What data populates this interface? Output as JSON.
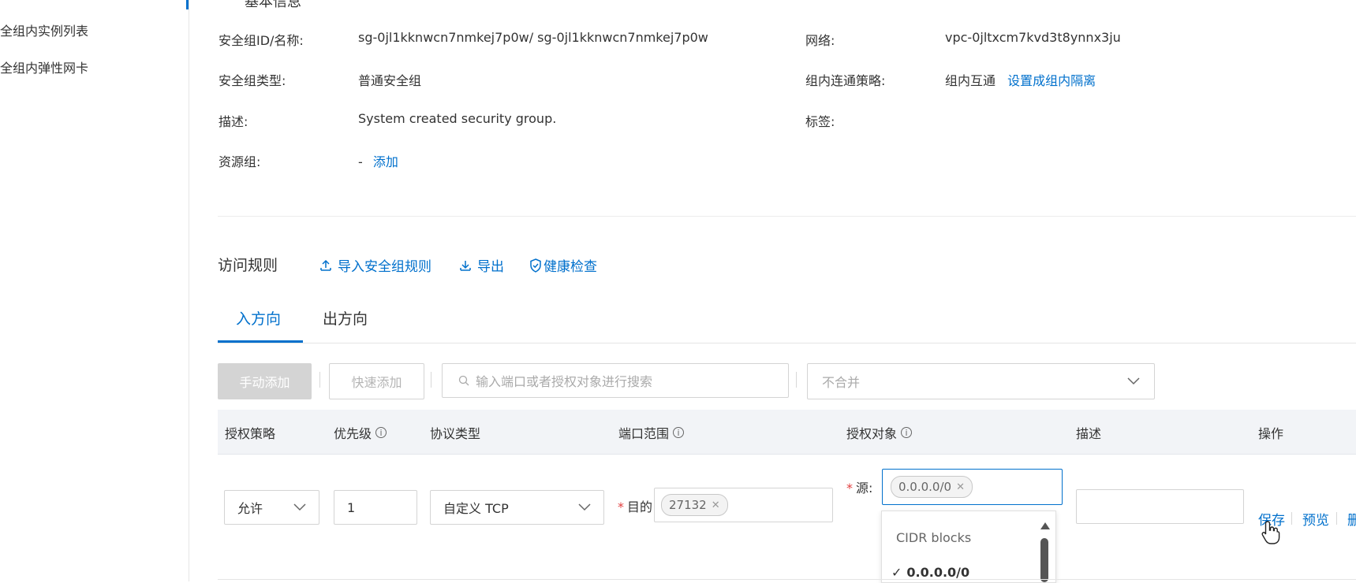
{
  "sidebar": {
    "items": [
      {
        "label": "安全组内实例列表"
      },
      {
        "label": "安全组内弹性网卡"
      }
    ]
  },
  "basic_info": {
    "section_title": "基本信息",
    "security_group_id_label": "安全组ID/名称:",
    "security_group_id_value": "sg-0jl1kknwcn7nmkej7p0w/ sg-0jl1kknwcn7nmkej7p0w",
    "network_label": "网络:",
    "network_value": "vpc-0jltxcm7kvd3t8ynnx3ju",
    "type_label": "安全组类型:",
    "type_value": "普通安全组",
    "policy_label": "组内连通策略:",
    "policy_value": "组内互通",
    "policy_link": "设置成组内隔离",
    "desc_label": "描述:",
    "desc_value": "System created security group.",
    "tags_label": "标签:",
    "resource_group_label": "资源组:",
    "resource_group_value": "-",
    "resource_group_link": "添加"
  },
  "access_rules": {
    "title": "访问规则",
    "import_label": "导入安全组规则",
    "export_label": "导出",
    "health_check_label": "健康检查",
    "import_icon": "upload-icon",
    "export_icon": "download-icon",
    "health_icon": "shield-check-icon"
  },
  "tabs": [
    {
      "label": "入方向",
      "active": true
    },
    {
      "label": "出方向",
      "active": false
    }
  ],
  "toolbar": {
    "manual_add_label": "手动添加",
    "quick_add_label": "快速添加",
    "search_placeholder": "输入端口或者授权对象进行搜索",
    "merge_select_value": "不合并"
  },
  "table": {
    "headers": [
      "授权策略",
      "优先级",
      "协议类型",
      "端口范围",
      "授权对象",
      "描述",
      "操作"
    ],
    "row": {
      "policy": "允许",
      "priority": "1",
      "protocol": "自定义 TCP",
      "port_prefix": "目的",
      "port_tag": "27132",
      "source_prefix": "源:",
      "source_tag": "0.0.0.0/0",
      "description": "",
      "actions": [
        "保存",
        "预览",
        "删除"
      ]
    }
  },
  "dropdown": {
    "header": "CIDR blocks",
    "selected_option": "0.0.0.0/0"
  },
  "colors": {
    "accent": "#0070cc",
    "required": "#e23f3f",
    "header_bg": "#f2f4f7"
  }
}
